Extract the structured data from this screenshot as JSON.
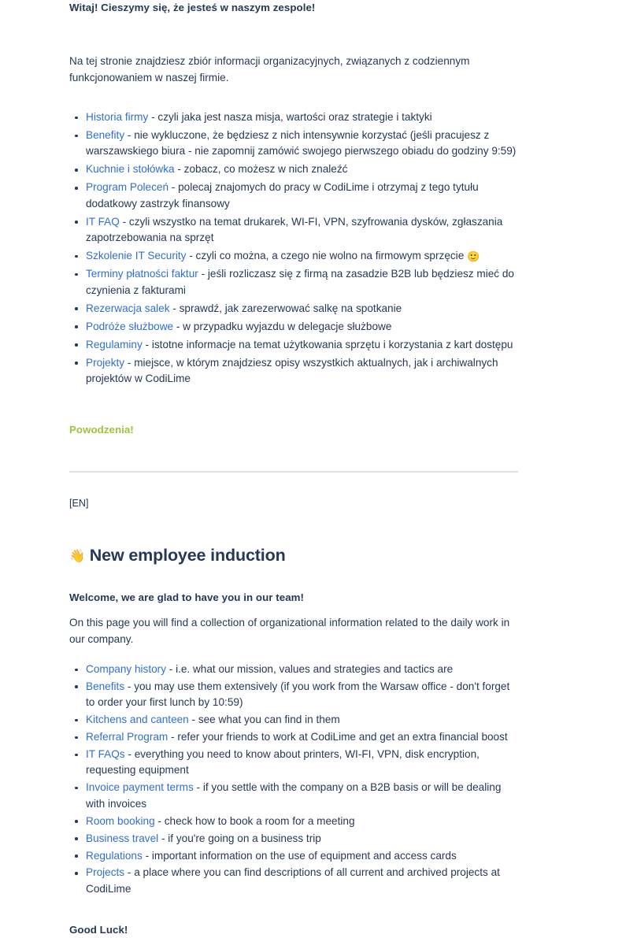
{
  "polish": {
    "welcome": "Witaj! Cieszymy się, że jesteś w naszym zespole!",
    "intro": "Na tej stronie znajdziesz zbiór informacji organizacyjnych, związanych z codziennym funkcjonowaniem w naszej firmie.",
    "items": [
      {
        "link": "Historia firmy",
        "desc": " - czyli jaka jest nasza misja, wartości oraz strategie i taktyki"
      },
      {
        "link": "Benefity",
        "desc": " - nie wykluczone, że będziesz z nich intensywnie korzystać (jeśli pracujesz z warszawskiego biura - nie zapomnij zamówić swojego pierwszego obiadu do godziny 9:59)"
      },
      {
        "link": "Kuchnie i stołówka",
        "desc": " - zobacz, co możesz w nich znaleźć"
      },
      {
        "link": "Program Poleceń",
        "desc": " - polecaj znajomych do pracy w CodiLime i otrzymaj z tego tytułu dodatkowy zastrzyk finansowy"
      },
      {
        "link": "IT FAQ",
        "desc": " - czyli wszystko na temat drukarek, WI-FI, VPN, szyfrowania dysków, zgłaszania zapotrzebowania na sprzęt"
      },
      {
        "link": "Szkolenie IT Security",
        "desc": " - czyli co można, a czego nie wolno na firmowym sprzęcie ",
        "emoji": "🙂"
      },
      {
        "link": "Terminy płatności faktur",
        "desc": " - jeśli rozliczasz się z firmą na zasadzie B2B lub będziesz mieć do czynienia z fakturami"
      },
      {
        "link": "Rezerwacja salek",
        "desc": " - sprawdź, jak zarezerwować salkę na spotkanie"
      },
      {
        "link": "Podróże służbowe",
        "desc": " - w przypadku wyjazdu w delegacje służbowe"
      },
      {
        "link": "Regulaminy",
        "desc": " - istotne informacje na temat użytkowania sprzętu i korzystania z kart dostępu"
      },
      {
        "link": "Projekty",
        "desc": " - miejsce, w którym znajdziesz opisy wszystkich aktualnych, jak i archiwalnych projektów w CodiLime"
      }
    ],
    "closing": "Powodzenia!"
  },
  "language_tag": "[EN]",
  "english": {
    "heading_emoji": "👋",
    "heading": "New employee induction",
    "welcome": "Welcome, we are glad to have you in our team!",
    "intro": "On this page you will find a collection of organizational information related to the daily work in our company.",
    "items": [
      {
        "link": "Company history",
        "desc": " - i.e. what our mission, values and strategies and tactics are"
      },
      {
        "link": "Benefits",
        "desc": " - you may use them extensively (if you work from the Warsaw office - don't forget to order your first lunch by 10:59)"
      },
      {
        "link": "Kitchens and canteen",
        "desc": " - see what you can find in them"
      },
      {
        "link": "Referral Program",
        "desc": " - refer your friends to work at CodiLime and get an extra financial boost"
      },
      {
        "link": "IT FAQs",
        "desc": " - everything you need to know about printers, WI-FI, VPN, disk encryption, requesting equipment"
      },
      {
        "link": "Invoice payment terms",
        "desc": " - if you settle with the company on a B2B basis or will be dealing with invoices"
      },
      {
        "link": "Room booking",
        "desc": " - check how to book a room for a meeting"
      },
      {
        "link": "Business travel",
        "desc": " - if you're going on a business trip"
      },
      {
        "link": "Regulations",
        "desc": " - important information on the use of equipment and access cards"
      },
      {
        "link": "Projects",
        "desc": " - a place where you can find descriptions of all current and archived projects at CodiLime"
      }
    ],
    "closing": "Good Luck!"
  },
  "colors": {
    "link": "#2f6fd0",
    "text": "#253858",
    "accent_green": "#9bc53d",
    "divider": "#dfe1e6"
  }
}
